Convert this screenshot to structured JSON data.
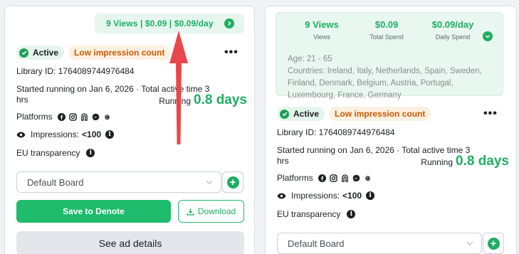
{
  "card1": {
    "summary": "9 Views | $0.09 | $0.09/day",
    "status": "Active",
    "impression_badge": "Low impression count",
    "more_label": "•••",
    "library_id": "Library ID: 1764089744976484",
    "started_line1": "Started running on Jan 6, 2026 · Total active time 3",
    "started_line2": "hrs",
    "running_label": "Running",
    "running_value": "0.8 days",
    "platforms_label": "Platforms",
    "impressions_label": "Impressions:",
    "impressions_value": "<100",
    "eu_label": "EU transparency",
    "board_value": "Default Board",
    "save_label": "Save to Denote",
    "download_label": "Download",
    "details_label": "See ad details"
  },
  "card2": {
    "stats": [
      {
        "value": "9 Views",
        "label": "Views"
      },
      {
        "value": "$0.09",
        "label": "Total Spend"
      },
      {
        "value": "$0.09/day",
        "label": "Daily Spend"
      }
    ],
    "age": "Age: 21 - 65",
    "countries": "Countries: Ireland, Italy, Netherlands, Spain, Sweden, Finland, Denmark, Belgium, Austria, Portugal, Luxembourg, France, Germany",
    "status": "Active",
    "impression_badge": "Low impression count",
    "more_label": "•••",
    "library_id": "Library ID: 1764089744976484",
    "started_line1": "Started running on Jan 6, 2026 · Total active time 3",
    "started_line2": "hrs",
    "running_label": "Running",
    "running_value": "0.8 days",
    "platforms_label": "Platforms",
    "impressions_label": "Impressions:",
    "impressions_value": "<100",
    "eu_label": "EU transparency",
    "board_value": "Default Board"
  },
  "icons": [
    "check-circle-icon",
    "info-icon",
    "more-icon",
    "facebook-icon",
    "instagram-icon",
    "audience-network-icon",
    "messenger-icon",
    "threads-icon",
    "eye-icon",
    "chevron-down-icon",
    "plus-icon",
    "download-icon",
    "arrow-icon"
  ],
  "colors": {
    "accent": "#1eae63",
    "warning": "#c85c05",
    "arrow": "#e8474b"
  }
}
